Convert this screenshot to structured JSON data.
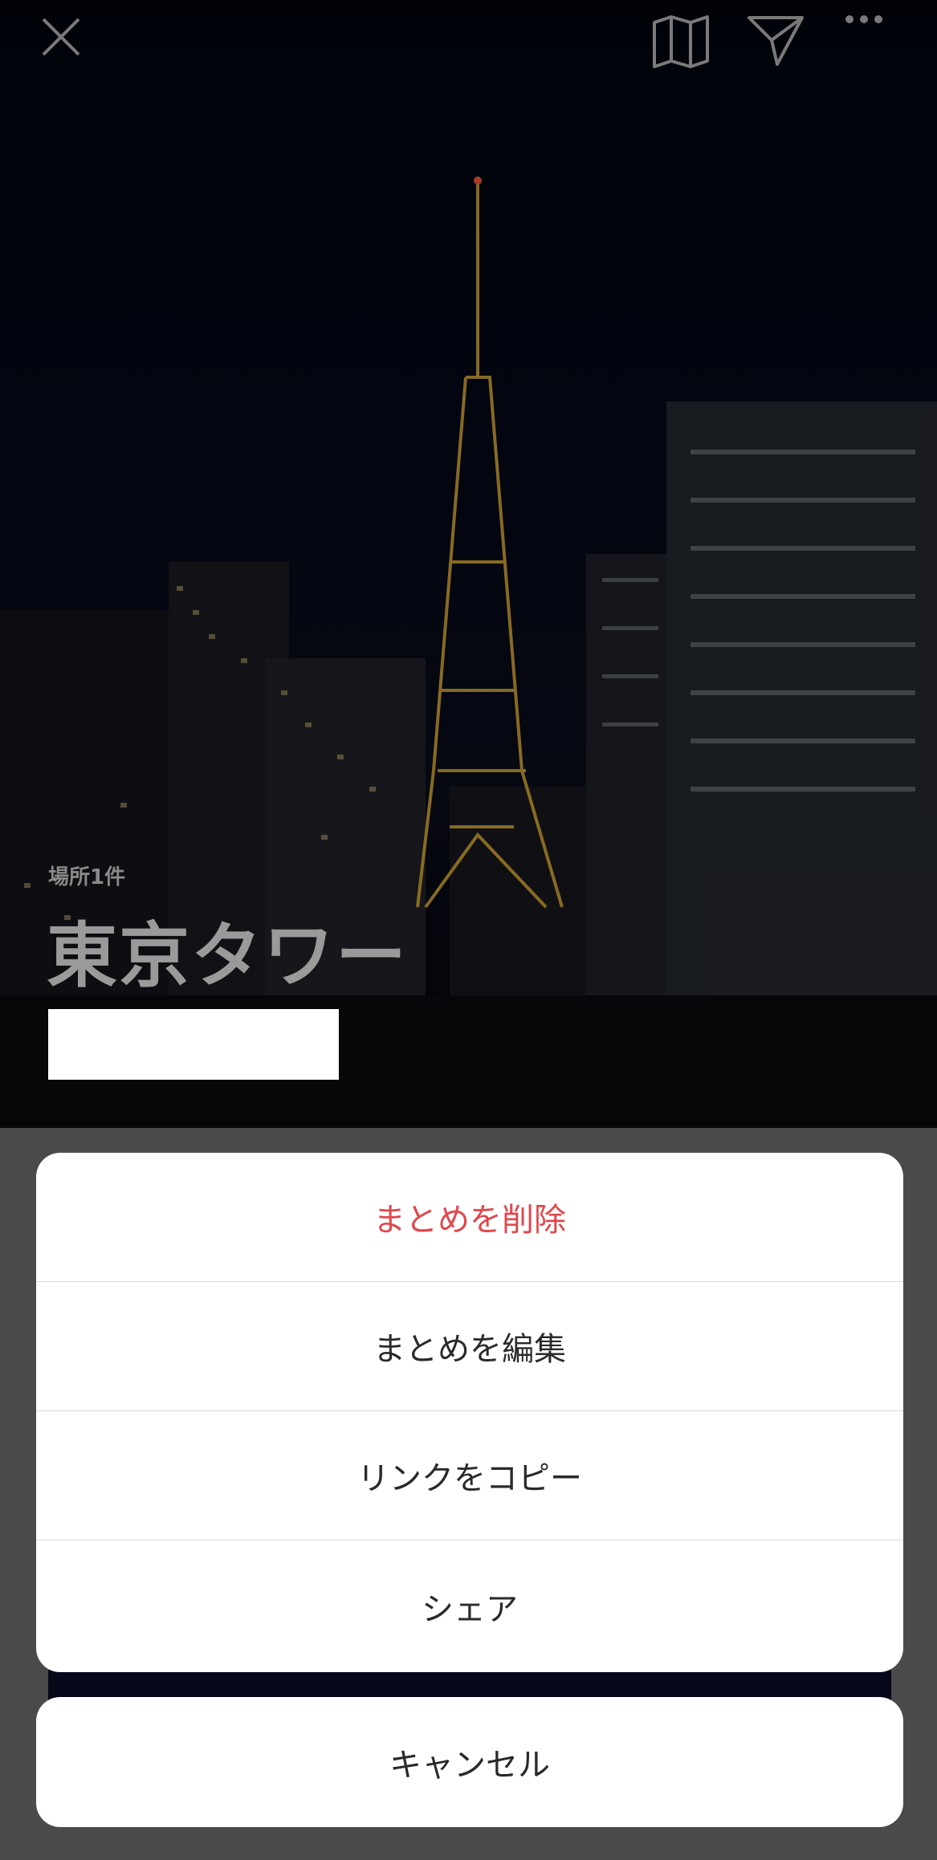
{
  "header": {
    "close_icon": "close-icon",
    "map_icon": "map-icon",
    "send_icon": "send-icon",
    "more_icon": "more-icon"
  },
  "collection": {
    "place_count": "場所1件",
    "title": "東京タワー"
  },
  "action_sheet": {
    "items": [
      {
        "label": "まとめを削除",
        "style": "destructive",
        "color": "#e0474c"
      },
      {
        "label": "まとめを編集",
        "style": "default"
      },
      {
        "label": "リンクをコピー",
        "style": "default"
      },
      {
        "label": "シェア",
        "style": "default"
      }
    ],
    "cancel_label": "キャンセル"
  }
}
